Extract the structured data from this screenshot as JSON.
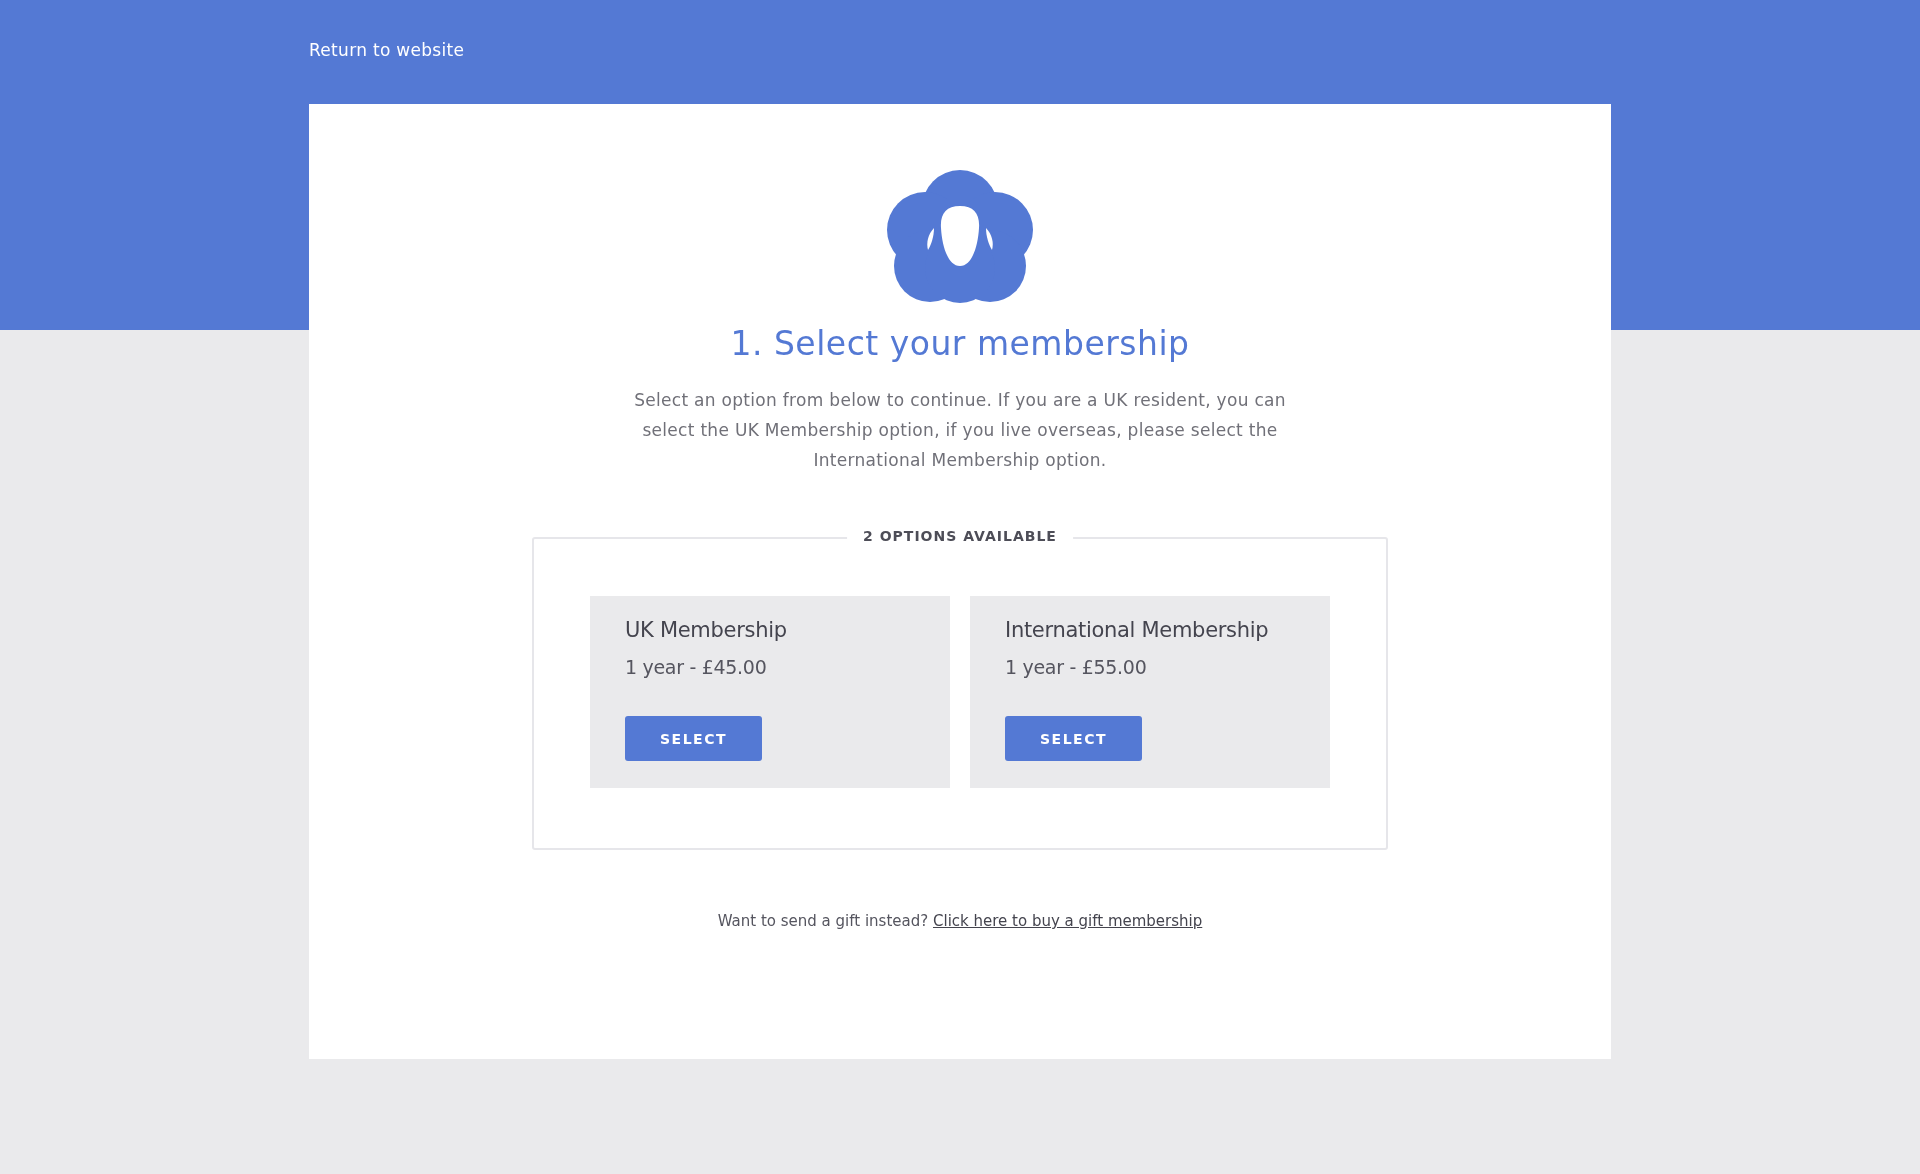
{
  "header": {
    "return_link": "Return to website"
  },
  "title": "1. Select your membership",
  "intro": "Select an option from below to continue. If you are a UK resident, you can select the UK Membership option, if you live overseas, please select the International Membership option.",
  "options_legend": "2 OPTIONS AVAILABLE",
  "options": [
    {
      "name": "UK Membership",
      "price": "1 year - £45.00",
      "button": "SELECT"
    },
    {
      "name": "International Membership",
      "price": "1 year - £55.00",
      "button": "SELECT"
    }
  ],
  "gift": {
    "text": "Want to send a gift instead?",
    "link": "Click here to buy a gift membership"
  }
}
